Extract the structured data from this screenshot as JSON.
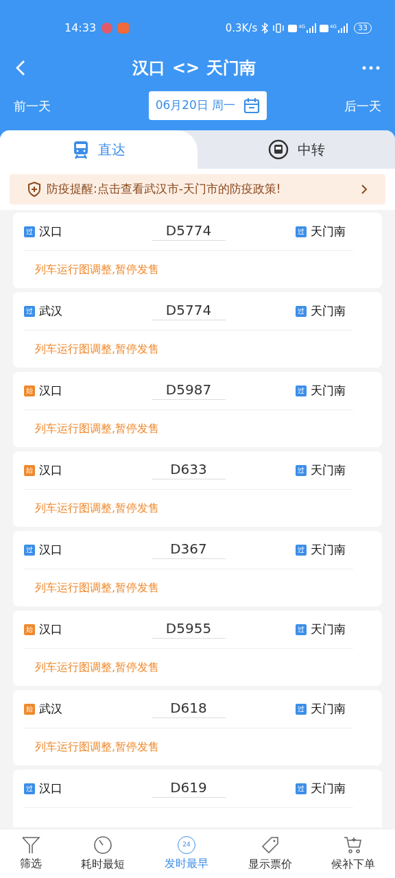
{
  "status_bar": {
    "time": "14:33",
    "speed": "0.3K/s",
    "network_1": "4G",
    "network_2": "4G",
    "battery": "33"
  },
  "header": {
    "from": "汉口",
    "swap": "<>",
    "to": "天门南"
  },
  "date_bar": {
    "prev": "前一天",
    "date": "06月20日 周一",
    "next": "后一天"
  },
  "tabs": [
    {
      "label": "直达",
      "selected": true
    },
    {
      "label": "中转",
      "selected": false
    }
  ],
  "notice": {
    "text": "防疫提醒:点击查看武汉市-天门市的防疫政策!"
  },
  "trains": [
    {
      "from_badge": {
        "text": "过",
        "color": "#3b8ee8"
      },
      "from": "汉口",
      "number": "D5774",
      "to_badge": {
        "text": "过",
        "color": "#3b8ee8"
      },
      "to": "天门南",
      "status": "列车运行图调整,暂停发售"
    },
    {
      "from_badge": {
        "text": "过",
        "color": "#3b8ee8"
      },
      "from": "武汉",
      "number": "D5774",
      "to_badge": {
        "text": "过",
        "color": "#3b8ee8"
      },
      "to": "天门南",
      "status": "列车运行图调整,暂停发售"
    },
    {
      "from_badge": {
        "text": "始",
        "color": "#f0882a"
      },
      "from": "汉口",
      "number": "D5987",
      "to_badge": {
        "text": "过",
        "color": "#3b8ee8"
      },
      "to": "天门南",
      "status": "列车运行图调整,暂停发售"
    },
    {
      "from_badge": {
        "text": "始",
        "color": "#f0882a"
      },
      "from": "汉口",
      "number": "D633",
      "to_badge": {
        "text": "过",
        "color": "#3b8ee8"
      },
      "to": "天门南",
      "status": "列车运行图调整,暂停发售"
    },
    {
      "from_badge": {
        "text": "过",
        "color": "#3b8ee8"
      },
      "from": "汉口",
      "number": "D367",
      "to_badge": {
        "text": "过",
        "color": "#3b8ee8"
      },
      "to": "天门南",
      "status": "列车运行图调整,暂停发售"
    },
    {
      "from_badge": {
        "text": "始",
        "color": "#f0882a"
      },
      "from": "汉口",
      "number": "D5955",
      "to_badge": {
        "text": "过",
        "color": "#3b8ee8"
      },
      "to": "天门南",
      "status": "列车运行图调整,暂停发售"
    },
    {
      "from_badge": {
        "text": "始",
        "color": "#f0882a"
      },
      "from": "武汉",
      "number": "D618",
      "to_badge": {
        "text": "过",
        "color": "#3b8ee8"
      },
      "to": "天门南",
      "status": "列车运行图调整,暂停发售"
    },
    {
      "from_badge": {
        "text": "过",
        "color": "#3b8ee8"
      },
      "from": "汉口",
      "number": "D619",
      "to_badge": {
        "text": "过",
        "color": "#3b8ee8"
      },
      "to": "天门南"
    }
  ],
  "bottom_bar": [
    {
      "label": "筛选",
      "kind": "filter",
      "selected": false
    },
    {
      "label": "耗时最短",
      "kind": "timer",
      "selected": false
    },
    {
      "label": "发时最早",
      "kind": "clock",
      "badge": "24",
      "selected": true
    },
    {
      "label": "显示票价",
      "kind": "tag",
      "selected": false
    },
    {
      "label": "候补下单",
      "kind": "cart",
      "selected": false
    }
  ]
}
